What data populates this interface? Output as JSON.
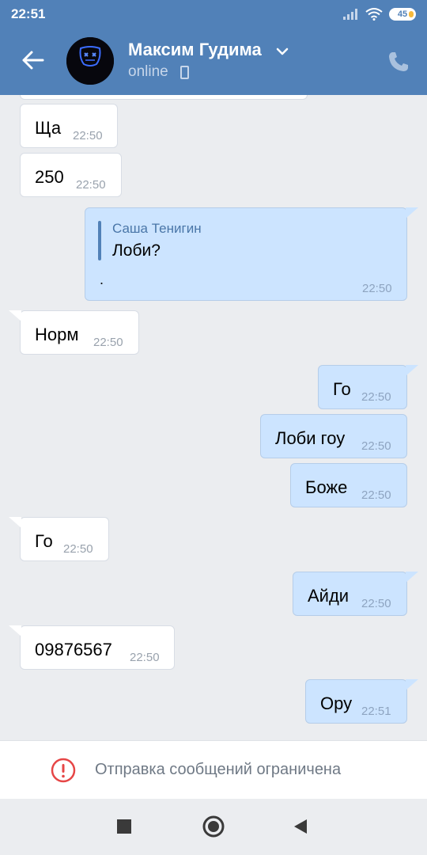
{
  "status_bar": {
    "time": "22:51",
    "battery": "45"
  },
  "header": {
    "name": "Максим Гудима",
    "presence": "online",
    "icons": {
      "back": "arrow-left-icon",
      "chevron": "chevron-down-icon",
      "device": "phone-device-icon",
      "call": "phone-call-icon"
    }
  },
  "messages": [
    {
      "dir": "in",
      "text": "Ща",
      "time": "22:50"
    },
    {
      "dir": "in",
      "text": "250",
      "time": "22:50"
    },
    {
      "dir": "out",
      "reply_author": "Саша Тенигин",
      "reply_text": "Лоби?",
      "text": ".",
      "time": "22:50"
    },
    {
      "dir": "in",
      "text": "Норм",
      "time": "22:50"
    },
    {
      "dir": "out",
      "text": "Го",
      "time": "22:50"
    },
    {
      "dir": "out",
      "text": "Лоби гоу",
      "time": "22:50"
    },
    {
      "dir": "out",
      "text": "Боже",
      "time": "22:50"
    },
    {
      "dir": "in",
      "text": "Го",
      "time": "22:50"
    },
    {
      "dir": "out",
      "text": "Айди",
      "time": "22:50"
    },
    {
      "dir": "in",
      "text": "09876567",
      "time": "22:50"
    },
    {
      "dir": "out",
      "text": "Ору",
      "time": "22:51"
    }
  ],
  "footer": {
    "restricted_text": "Отправка сообщений ограничена",
    "icon": "exclamation-circle-icon"
  },
  "colors": {
    "header": "#5181b8",
    "outgoing": "#cce4ff",
    "incoming": "#ffffff",
    "background": "#ebedf0",
    "alert": "#e64646"
  },
  "nav": {
    "icons": [
      "square-recents-icon",
      "circle-home-icon",
      "triangle-back-icon"
    ]
  }
}
